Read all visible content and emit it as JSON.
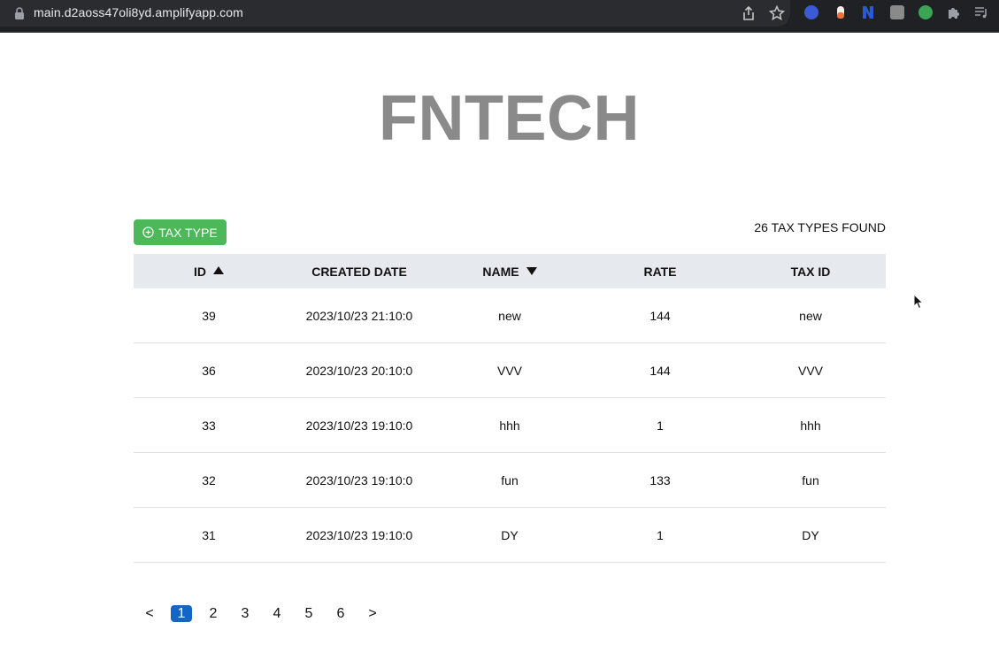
{
  "browser": {
    "url": "main.d2aoss47oli8yd.amplifyapp.com"
  },
  "page": {
    "logo": "FNTECH",
    "add_button_label": "TAX TYPE",
    "found_text": "26 tax types found"
  },
  "table": {
    "columns": [
      "ID",
      "CREATED DATE",
      "NAME",
      "RATE",
      "TAX ID"
    ],
    "rows": [
      [
        "39",
        "2023/10/23 21:10:0",
        "new",
        "144",
        "new"
      ],
      [
        "36",
        "2023/10/23 20:10:0",
        "VVV",
        "144",
        "VVV"
      ],
      [
        "33",
        "2023/10/23 19:10:0",
        "hhh",
        "1",
        "hhh"
      ],
      [
        "32",
        "2023/10/23 19:10:0",
        "fun",
        "133",
        "fun"
      ],
      [
        "31",
        "2023/10/23 19:10:0",
        "DY",
        "1",
        "DY"
      ]
    ]
  },
  "pagination": {
    "prev": "<",
    "next": ">",
    "pages": [
      "1",
      "2",
      "3",
      "4",
      "5",
      "6"
    ],
    "current": "1"
  },
  "colors": {
    "add_button": "#4cb85a",
    "active_page": "#1466c4",
    "header_bg": "#e6eaee",
    "logo": "#8a8a8a"
  }
}
